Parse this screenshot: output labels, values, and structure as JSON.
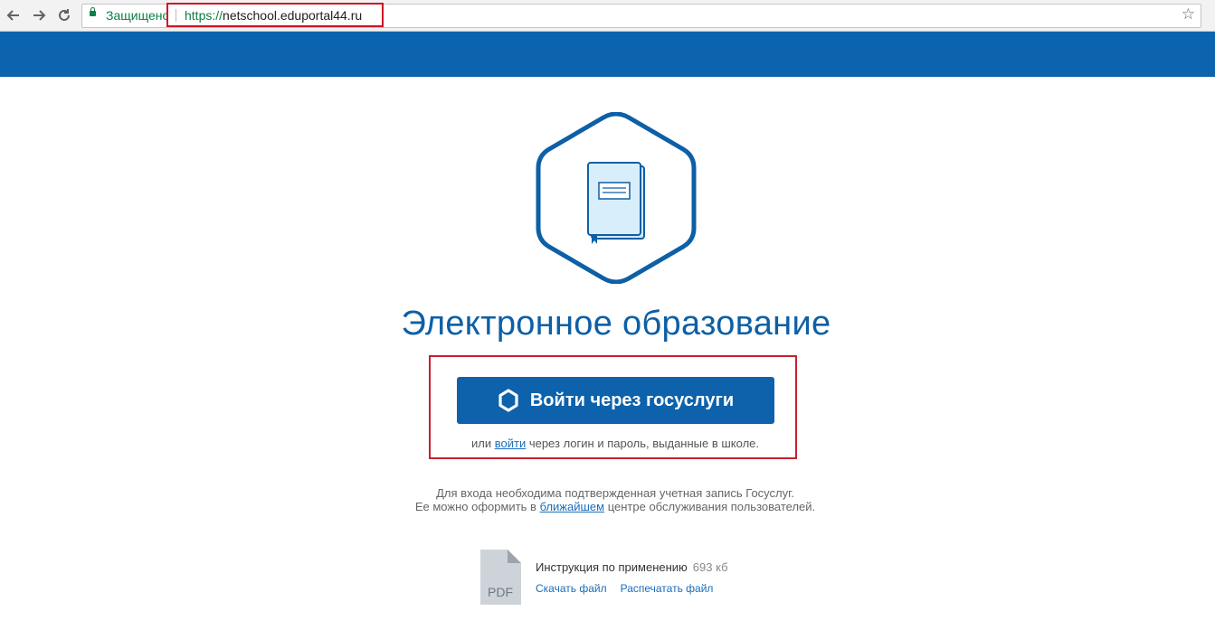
{
  "browser": {
    "secure_label": "Защищено",
    "url_scheme": "https://",
    "url_host": "netschool.eduportal44.ru"
  },
  "colors": {
    "brand_blue": "#0d64ae",
    "highlight_red": "#c8202e",
    "link": "#1a6ebb"
  },
  "main": {
    "title": "Электронное образование",
    "gosuslugi_button": "Войти через госуслуги",
    "alt_prefix": "или",
    "alt_link": "войти",
    "alt_suffix": "через логин и пароль, выданные в школе.",
    "info_line1": "Для входа необходима подтвержденная учетная запись Госуслуг.",
    "info_line2_prefix": "Ее можно оформить в",
    "info_line2_link": "ближайшем",
    "info_line2_suffix": "центре обслуживания пользователей."
  },
  "document": {
    "icon_label": "PDF",
    "title": "Инструкция по применению",
    "size": "693 кб",
    "download": "Скачать файл",
    "print": "Распечатать файл"
  },
  "icons": {
    "back": "back-arrow-icon",
    "forward": "forward-arrow-icon",
    "reload": "reload-icon",
    "lock": "lock-icon",
    "bookmark": "star-icon",
    "logo": "hexagon-book-icon",
    "gos": "hexagon-icon",
    "pdf": "pdf-file-icon"
  }
}
